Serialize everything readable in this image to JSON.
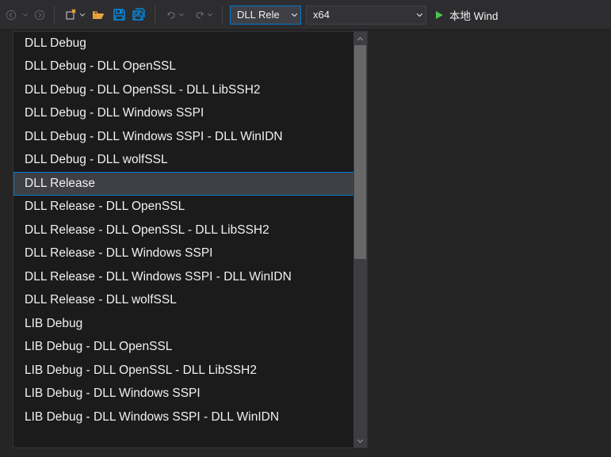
{
  "toolbar": {
    "config_selected": "DLL Rele",
    "platform_selected": "x64",
    "run_label": "本地 Wind"
  },
  "config_dropdown": {
    "selected": "DLL Release",
    "items": [
      "DLL Debug",
      "DLL Debug - DLL OpenSSL",
      "DLL Debug - DLL OpenSSL - DLL LibSSH2",
      "DLL Debug - DLL Windows SSPI",
      "DLL Debug - DLL Windows SSPI - DLL WinIDN",
      "DLL Debug - DLL wolfSSL",
      "DLL Release",
      "DLL Release - DLL OpenSSL",
      "DLL Release - DLL OpenSSL - DLL LibSSH2",
      "DLL Release - DLL Windows SSPI",
      "DLL Release - DLL Windows SSPI - DLL WinIDN",
      "DLL Release - DLL wolfSSL",
      "LIB Debug",
      "LIB Debug - DLL OpenSSL",
      "LIB Debug - DLL OpenSSL - DLL LibSSH2",
      "LIB Debug - DLL Windows SSPI",
      "LIB Debug - DLL Windows SSPI - DLL WinIDN"
    ]
  }
}
